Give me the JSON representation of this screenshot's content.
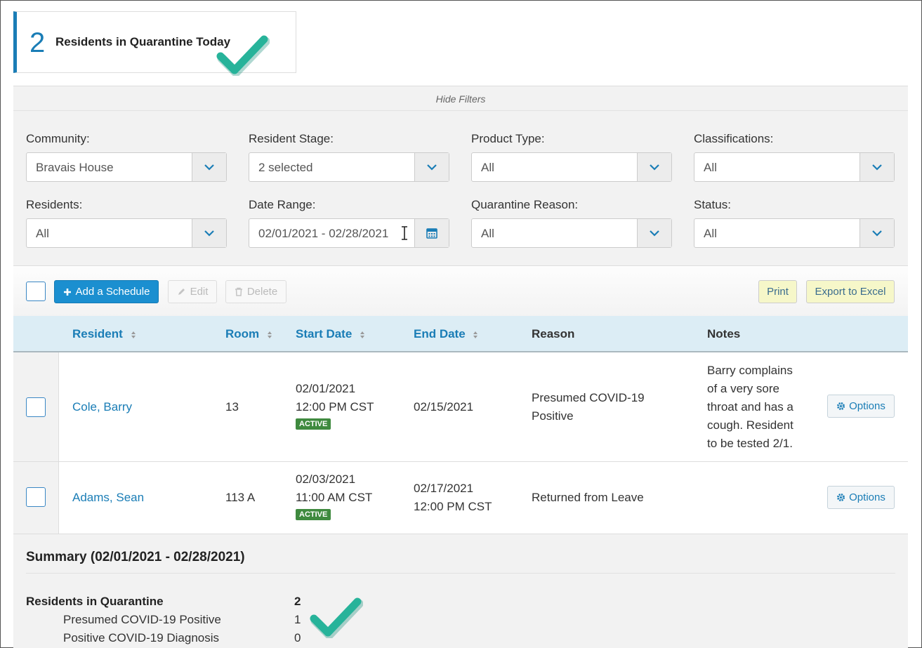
{
  "kpi": {
    "count": "2",
    "label": "Residents in Quarantine Today"
  },
  "filters": {
    "toggle_label": "Hide Filters",
    "community": {
      "label": "Community:",
      "value": "Bravais House"
    },
    "resident_stage": {
      "label": "Resident Stage:",
      "value": "2 selected"
    },
    "product_type": {
      "label": "Product Type:",
      "value": "All"
    },
    "classifications": {
      "label": "Classifications:",
      "value": "All"
    },
    "residents": {
      "label": "Residents:",
      "value": "All"
    },
    "date_range": {
      "label": "Date Range:",
      "value": "02/01/2021 - 02/28/2021"
    },
    "quarantine_reason": {
      "label": "Quarantine Reason:",
      "value": "All"
    },
    "status": {
      "label": "Status:",
      "value": "All"
    }
  },
  "toolbar": {
    "add_label": "Add a Schedule",
    "edit_label": "Edit",
    "delete_label": "Delete",
    "print_label": "Print",
    "export_label": "Export to Excel"
  },
  "table": {
    "headers": {
      "resident": "Resident",
      "room": "Room",
      "start_date": "Start Date",
      "end_date": "End Date",
      "reason": "Reason",
      "notes": "Notes"
    },
    "rows": [
      {
        "resident": "Cole, Barry",
        "room": "13",
        "start_date": "02/01/2021",
        "start_time": "12:00 PM CST",
        "status": "ACTIVE",
        "end_date": "02/15/2021",
        "end_time": "",
        "reason_line1": "Presumed COVID-19",
        "reason_line2": "Positive",
        "notes_lines": [
          "Barry complains",
          "of a very sore",
          "throat and has a",
          "cough. Resident",
          "to be tested 2/1."
        ],
        "options_label": "Options"
      },
      {
        "resident": "Adams, Sean",
        "room": "113 A",
        "start_date": "02/03/2021",
        "start_time": "11:00 AM CST",
        "status": "ACTIVE",
        "end_date": "02/17/2021",
        "end_time": "12:00 PM CST",
        "reason_line1": "Returned from Leave",
        "reason_line2": "",
        "notes_lines": [],
        "options_label": "Options"
      }
    ]
  },
  "summary": {
    "title": "Summary (02/01/2021 - 02/28/2021)",
    "total_label": "Residents in Quarantine",
    "total_value": "2",
    "items": [
      {
        "label": "Presumed COVID-19 Positive",
        "value": "1"
      },
      {
        "label": "Positive COVID-19 Diagnosis",
        "value": "0"
      }
    ]
  },
  "colors": {
    "accent": "#1a7db6",
    "primary_button": "#1b8fd0",
    "active_badge": "#3f8a3f",
    "check": "#27b39a"
  }
}
